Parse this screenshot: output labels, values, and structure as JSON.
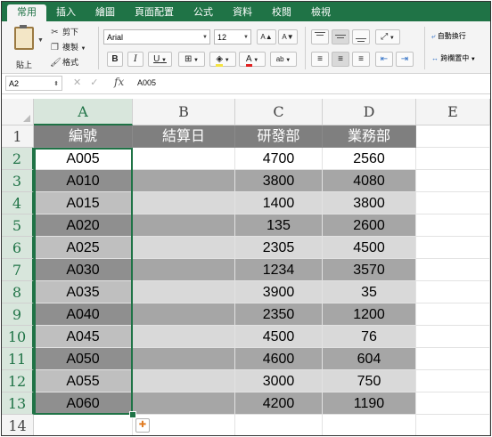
{
  "ribbon_tabs": [
    "常用",
    "插入",
    "繪圖",
    "頁面配置",
    "公式",
    "資料",
    "校閱",
    "檢視"
  ],
  "clipboard": {
    "paste_label": "貼上",
    "cut_label": "剪下",
    "copy_label": "複製",
    "format_label": "格式"
  },
  "font": {
    "name": "Arial",
    "size": "12",
    "grow_label": "A▲",
    "shrink_label": "A▼",
    "bold": "B",
    "italic": "I",
    "underline": "U"
  },
  "alignment": {
    "wrap_label": "自動換行",
    "merge_label": "跨欄置中"
  },
  "formula_bar": {
    "name_box": "A2",
    "fx": "fx",
    "value": "A005"
  },
  "columns": [
    "A",
    "B",
    "C",
    "D",
    "E"
  ],
  "row_numbers": [
    "1",
    "2",
    "3",
    "4",
    "5",
    "6",
    "7",
    "8",
    "9",
    "10",
    "11",
    "12",
    "13",
    "14"
  ],
  "table": {
    "headers": [
      "編號",
      "結算日",
      "研發部",
      "業務部"
    ],
    "rows": [
      [
        "A005",
        "",
        "4700",
        "2560"
      ],
      [
        "A010",
        "",
        "3800",
        "4080"
      ],
      [
        "A015",
        "",
        "1400",
        "3800"
      ],
      [
        "A020",
        "",
        "135",
        "2600"
      ],
      [
        "A025",
        "",
        "2305",
        "4500"
      ],
      [
        "A030",
        "",
        "1234",
        "3570"
      ],
      [
        "A035",
        "",
        "3900",
        "35"
      ],
      [
        "A040",
        "",
        "2350",
        "1200"
      ],
      [
        "A045",
        "",
        "4500",
        "76"
      ],
      [
        "A050",
        "",
        "4600",
        "604"
      ],
      [
        "A055",
        "",
        "3000",
        "750"
      ],
      [
        "A060",
        "",
        "4200",
        "1190"
      ]
    ]
  },
  "colors": {
    "accent": "#1f7346",
    "header_fill": "#7f7f7f",
    "band_light": "#d9d9d9",
    "band_dark": "#a6a6a6"
  }
}
